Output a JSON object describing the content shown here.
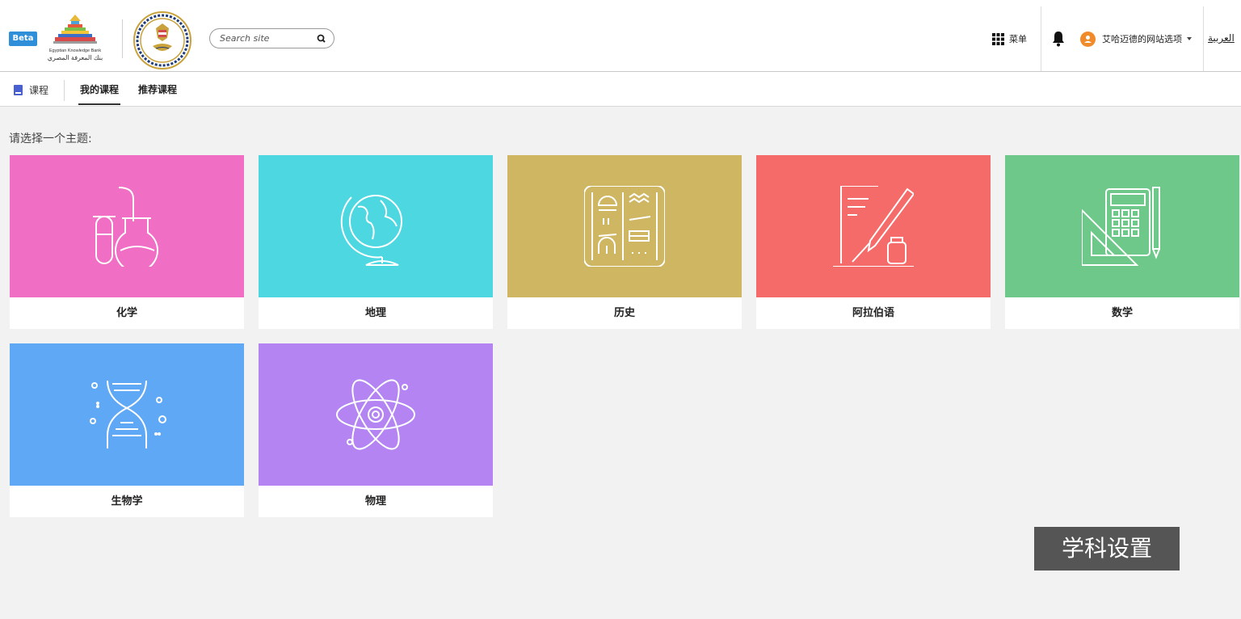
{
  "header": {
    "beta_label": "Beta",
    "ekb_name_en": "Egyptian Knowledge Bank",
    "ekb_name_ar": "بنك المعرفة المصري",
    "search_placeholder": "Search site",
    "menu_label": "菜单",
    "user_label": "艾哈迈德的网站选项",
    "language_link": "العربية"
  },
  "tabs": {
    "breadcrumb": "课程",
    "items": [
      {
        "label": "我的课程",
        "active": true
      },
      {
        "label": "推荐课程",
        "active": false
      }
    ]
  },
  "main": {
    "prompt": "请选择一个主题:",
    "subjects": [
      {
        "label": "化学",
        "color": "#f06fc4",
        "icon": "flask-icon"
      },
      {
        "label": "地理",
        "color": "#4cd7e1",
        "icon": "globe-icon"
      },
      {
        "label": "历史",
        "color": "#cfb663",
        "icon": "hieroglyph-icon"
      },
      {
        "label": "阿拉伯语",
        "color": "#f56b69",
        "icon": "pen-ink-icon"
      },
      {
        "label": "数学",
        "color": "#6ec88a",
        "icon": "calculator-icon"
      },
      {
        "label": "生物学",
        "color": "#5fa8f5",
        "icon": "dna-icon"
      },
      {
        "label": "物理",
        "color": "#b384f2",
        "icon": "atom-icon"
      }
    ]
  },
  "toast": {
    "label": "学科设置"
  }
}
